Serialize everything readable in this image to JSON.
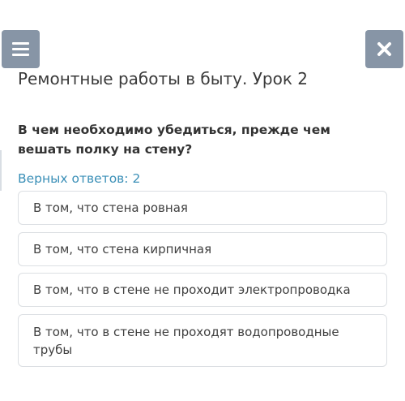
{
  "header": {
    "menu_icon": "hamburger-menu-icon",
    "close_icon": "close-icon"
  },
  "lesson": {
    "title": "Ремонтные работы в быту. Урок 2"
  },
  "question": {
    "text": "В чем необходимо убедиться, прежде чем вешать полку на стену?",
    "correct_answers_label": "Верных ответов: 2"
  },
  "options": [
    {
      "label": "В том, что стена ровная"
    },
    {
      "label": "В том, что стена кирпичная"
    },
    {
      "label": "В том, что в стене не проходит электропроводка"
    },
    {
      "label": "В том, что в стене не проходят водопроводные трубы"
    }
  ]
}
